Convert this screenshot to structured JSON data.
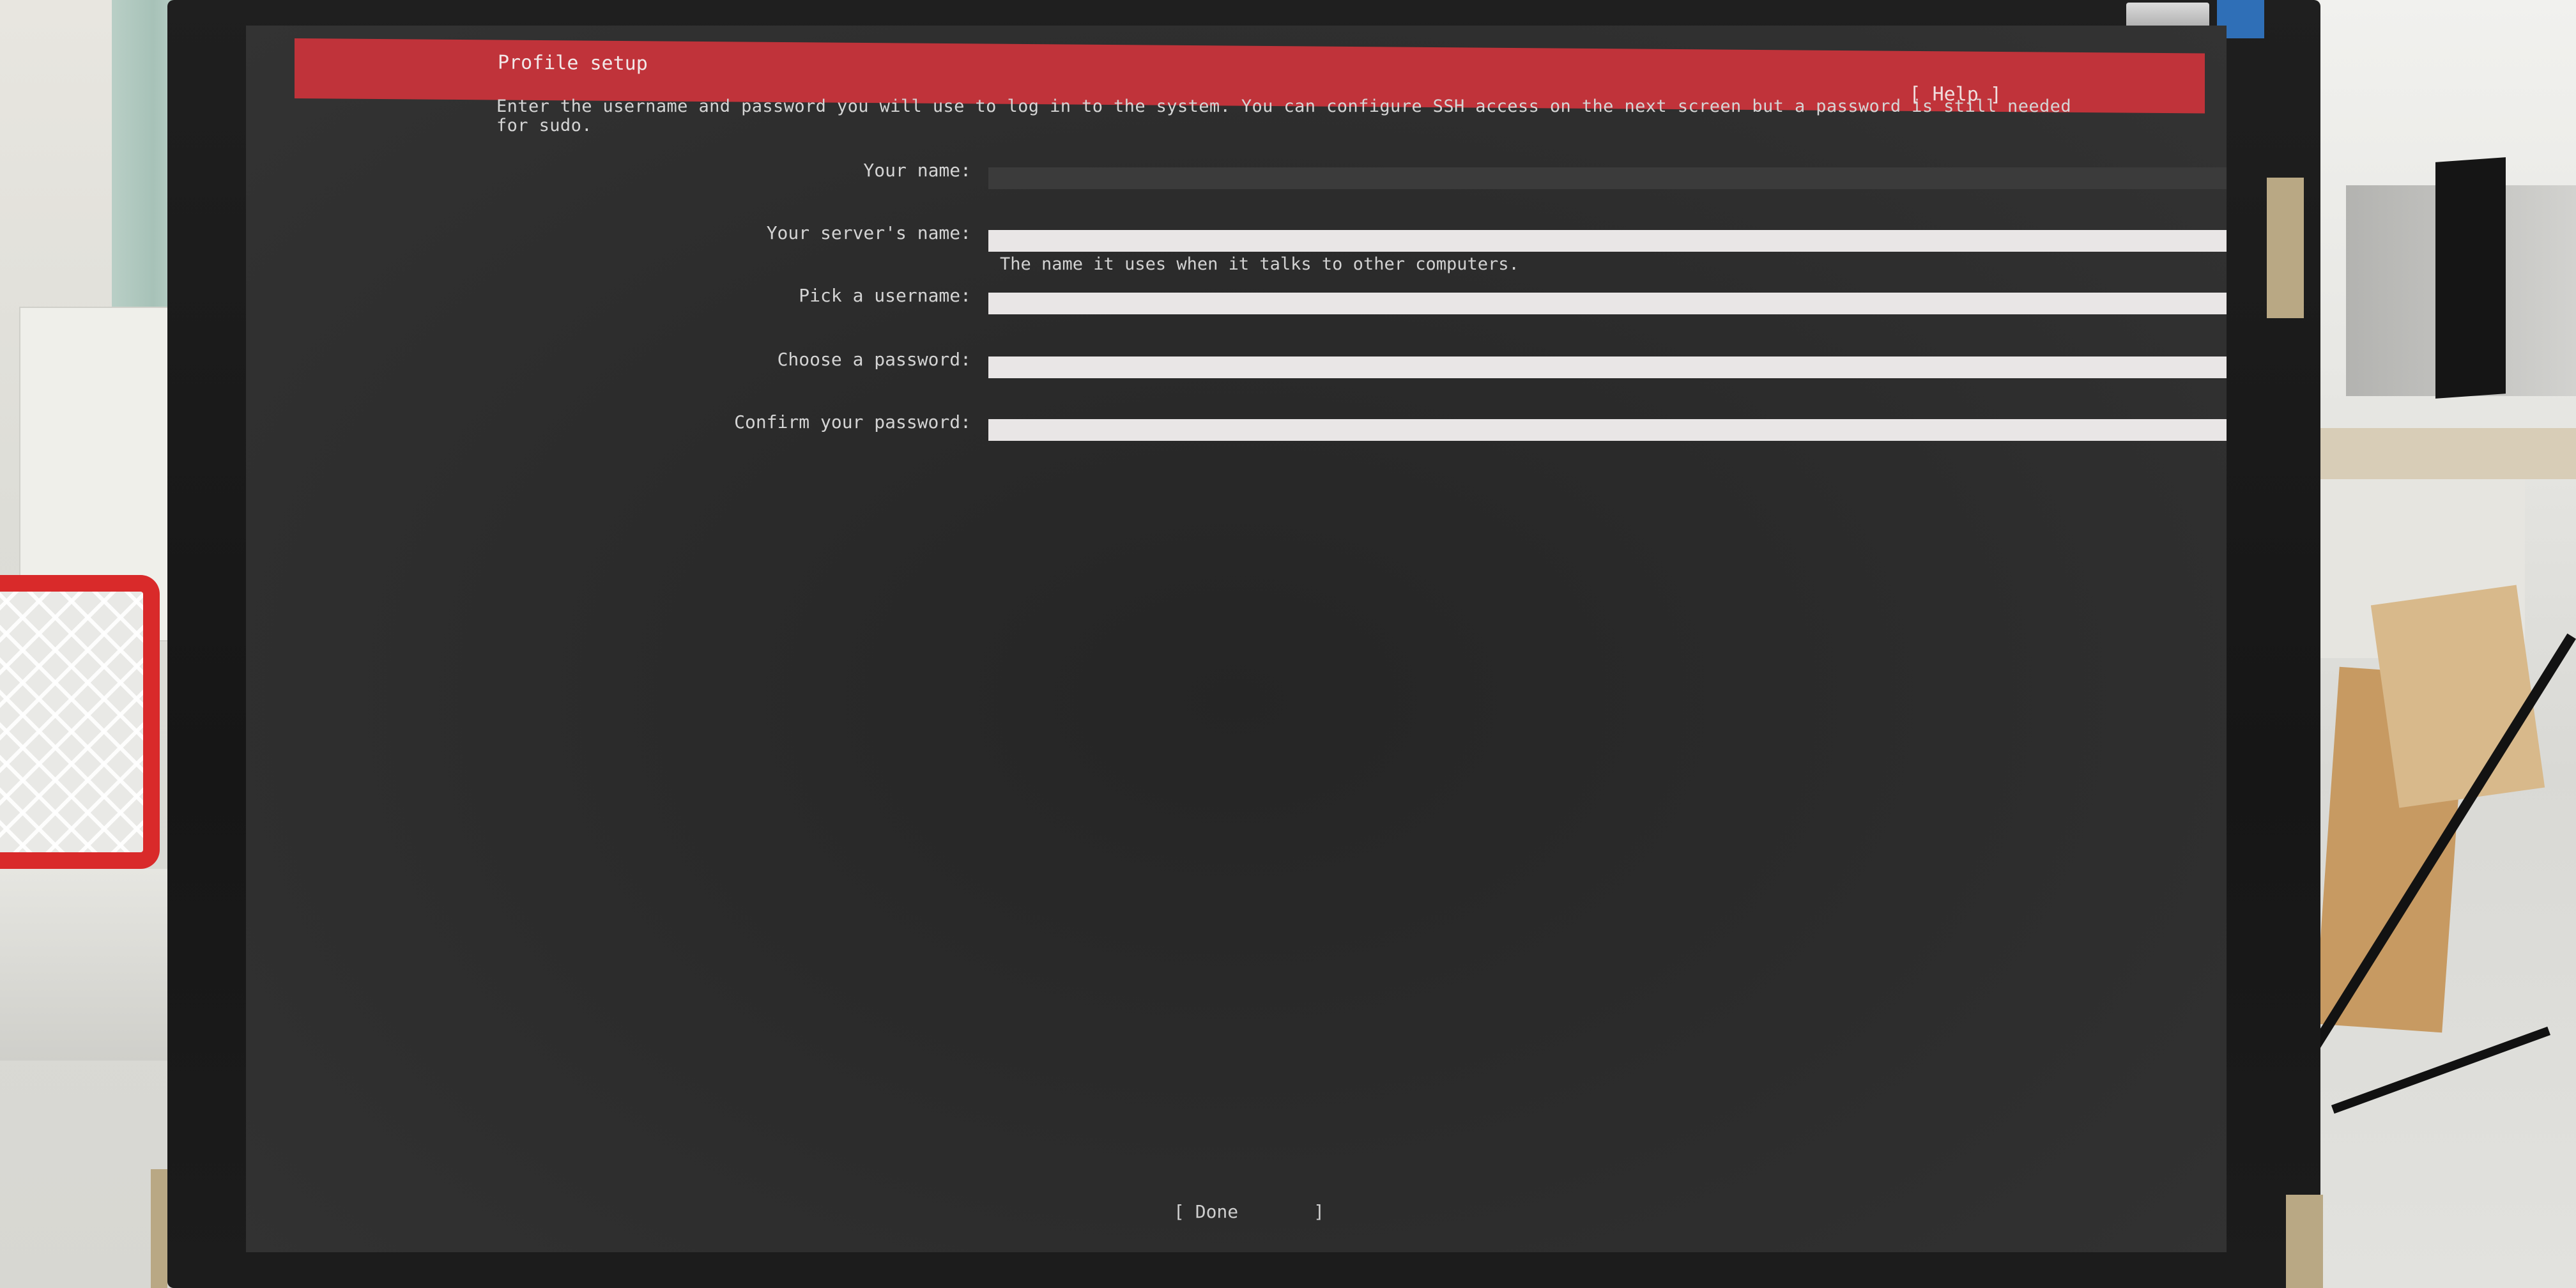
{
  "installer": {
    "header_title": "Profile setup",
    "help_label": "[ Help ]",
    "intro": "Enter the username and password you will use to log in to the system. You can configure SSH access on the next screen but a password is still needed for sudo.",
    "fields": [
      {
        "label": "Your name:",
        "value": "",
        "focused": true
      },
      {
        "label": "Your server's name:",
        "value": ""
      },
      {
        "label": "Pick a username:",
        "value": ""
      },
      {
        "label": "Choose a password:",
        "value": ""
      },
      {
        "label": "Confirm your password:",
        "value": ""
      }
    ],
    "server_name_hint": "The name it uses when it talks to other computers.",
    "done_label": "[ Done       ]"
  },
  "colors": {
    "header_bg": "#c0333a",
    "screen_bg": "#2b2b2b",
    "field_bg": "#e9e6e6",
    "focused_field_bg": "#3b3b3b",
    "text": "#d4d4d4"
  }
}
